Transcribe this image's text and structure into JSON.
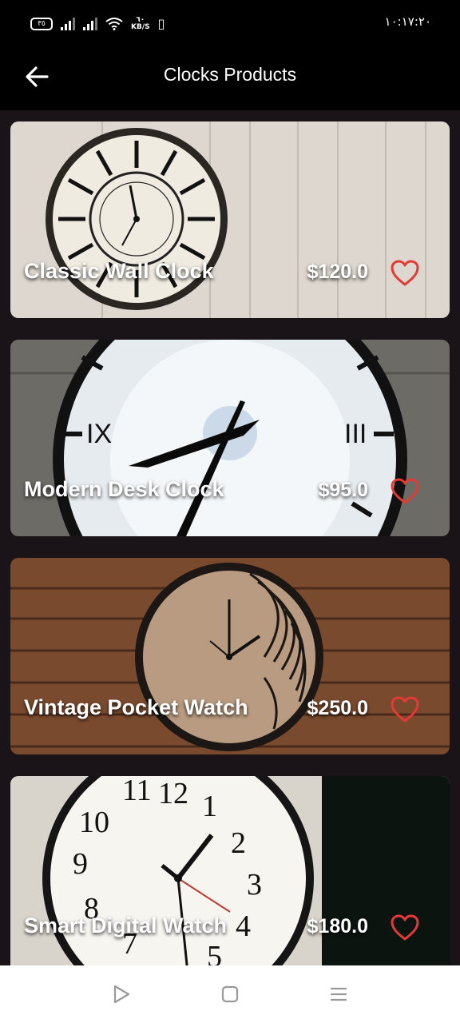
{
  "status_bar": {
    "battery": "٣٥",
    "network_speed_value": "٦٠",
    "network_speed_unit": "KB/S",
    "time": "١٠:١٧:٢٠"
  },
  "app_bar": {
    "title": "Clocks Products",
    "back_icon": "arrow-left-icon"
  },
  "products": [
    {
      "name": "Classic Wall Clock",
      "price": "$120.0",
      "favorite": false,
      "image": "classic-wall-clock-photo"
    },
    {
      "name": "Modern Desk Clock",
      "price": "$95.0",
      "favorite": false,
      "image": "modern-desk-clock-photo"
    },
    {
      "name": "Vintage Pocket Watch",
      "price": "$250.0",
      "favorite": false,
      "image": "wooden-wall-clock-photo"
    },
    {
      "name": "Smart Digital Watch",
      "price": "$180.0",
      "favorite": false,
      "image": "office-wall-clock-photo"
    }
  ],
  "nav_bar": {
    "back_icon": "triangle-back-icon",
    "home_icon": "square-home-icon",
    "menu_icon": "menu-lines-icon"
  },
  "colors": {
    "background": "#1a1418",
    "bars": "#000000",
    "heart": "#e53935",
    "nav_bar": "#ffffff"
  }
}
